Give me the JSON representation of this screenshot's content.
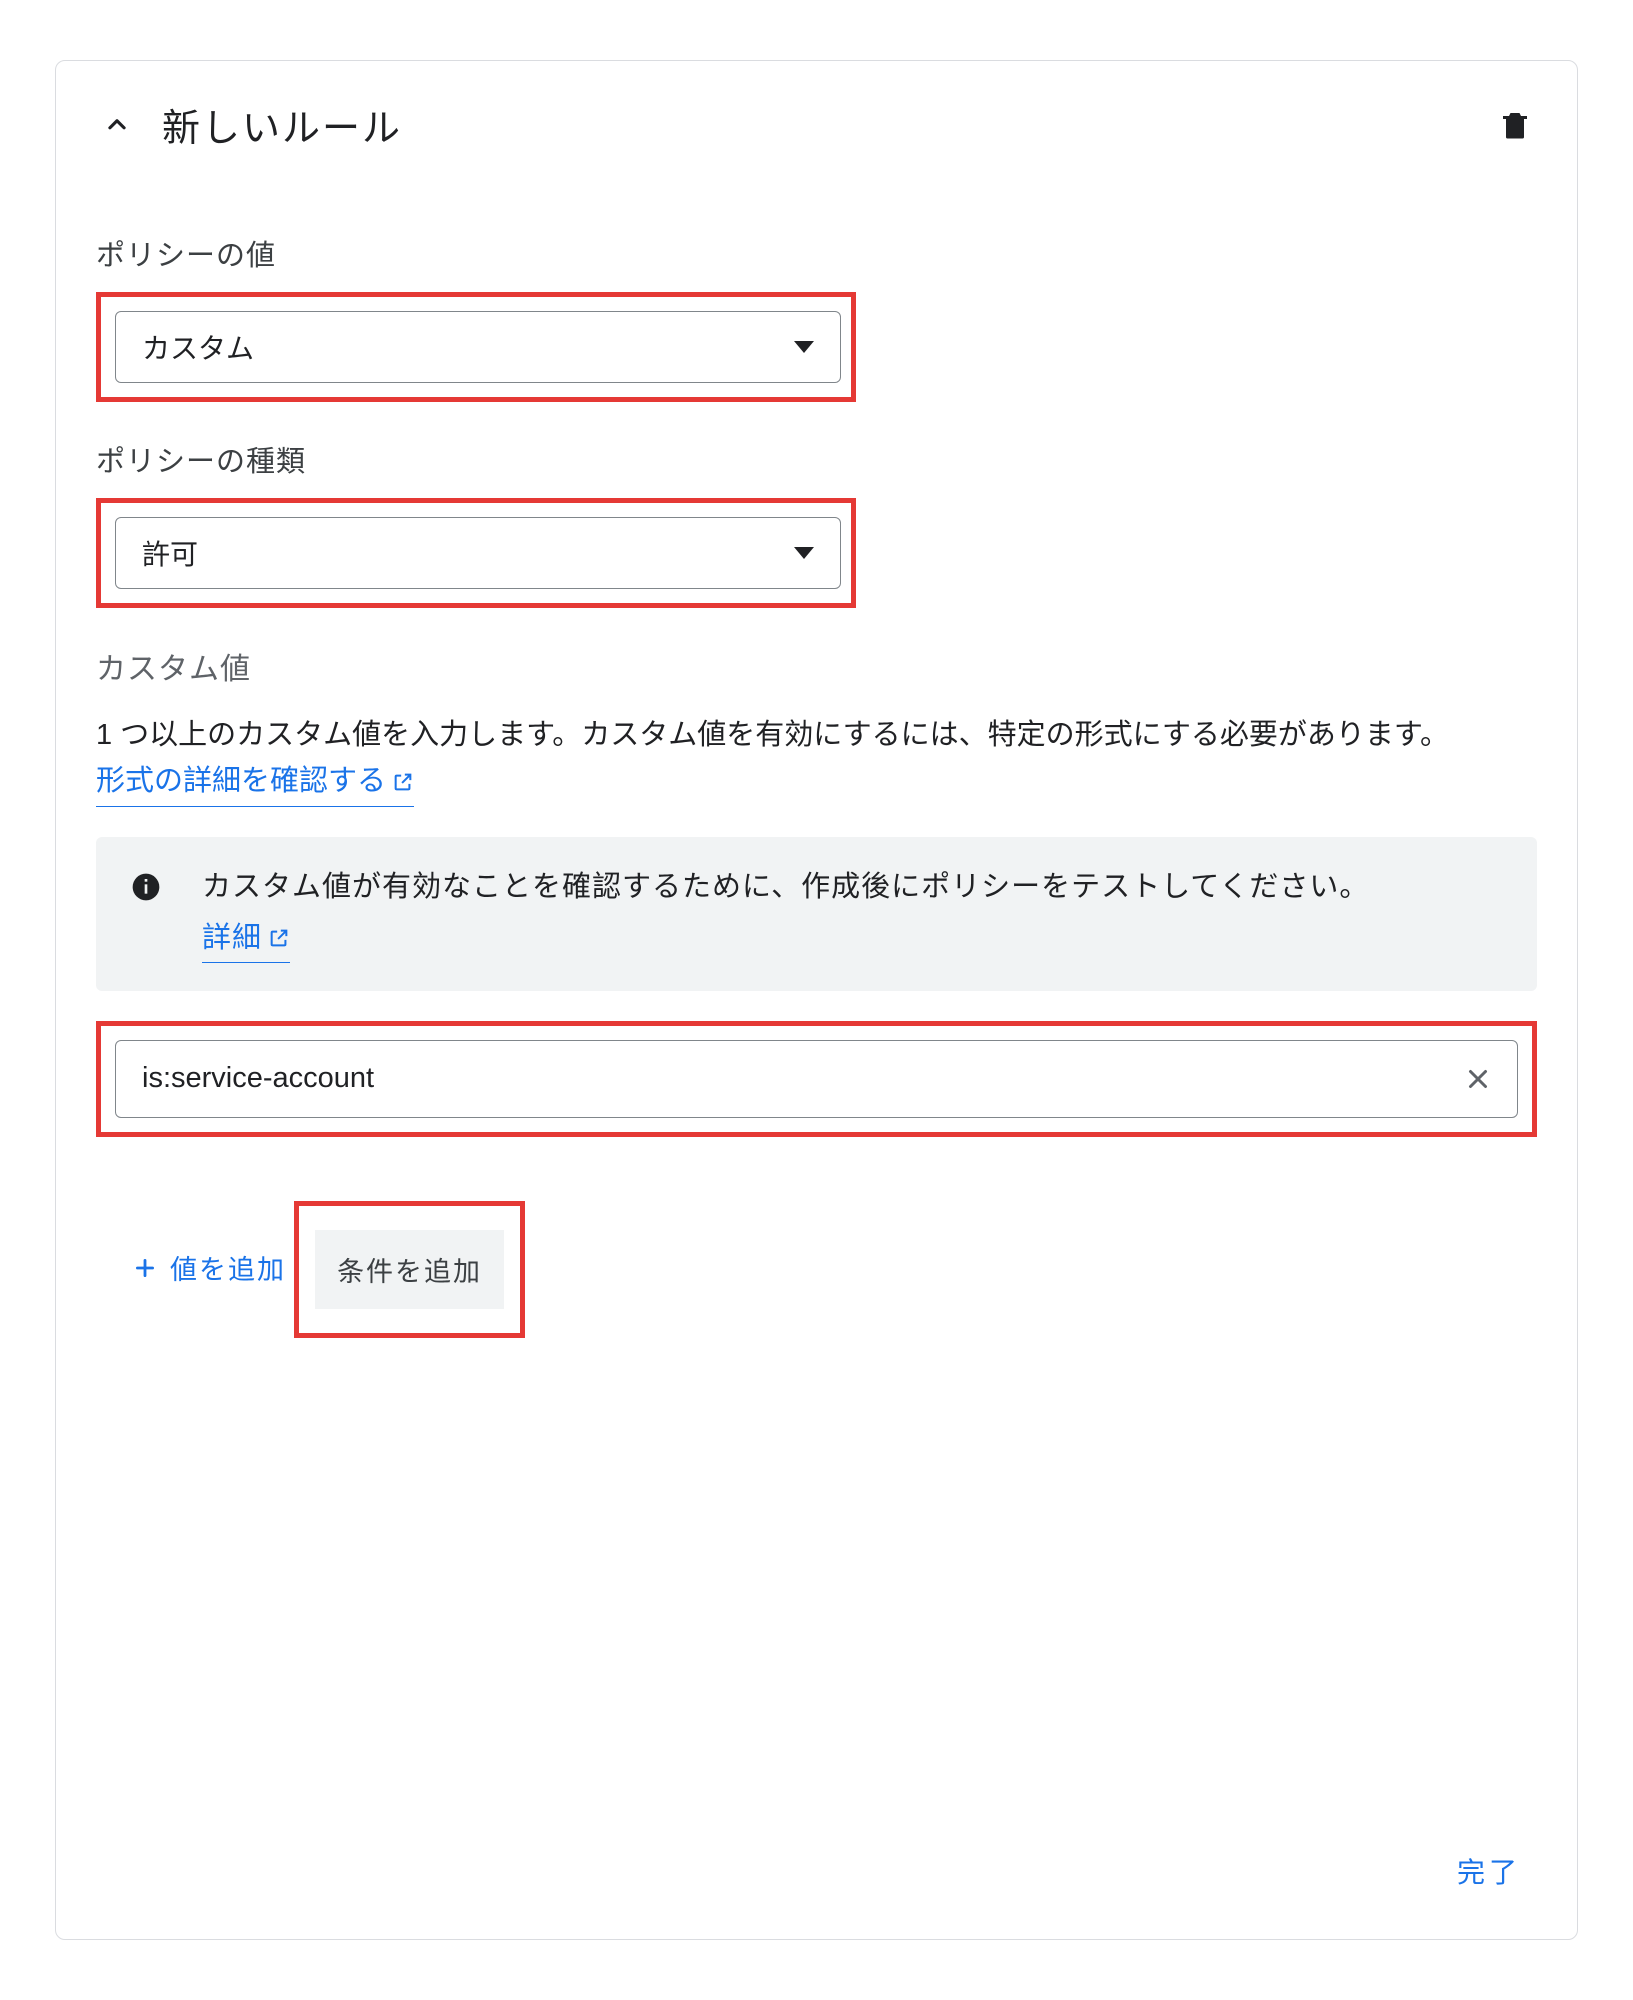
{
  "header": {
    "title": "新しいルール"
  },
  "policyValue": {
    "label": "ポリシーの値",
    "selected": "カスタム"
  },
  "policyType": {
    "label": "ポリシーの種類",
    "selected": "許可"
  },
  "customValues": {
    "title": "カスタム値",
    "description": "1 つ以上のカスタム値を入力します。カスタム値を有効にするには、特定の形式にする必要があります。",
    "formatLink": "形式の詳細を確認する",
    "infoText": "カスタム値が有効なことを確認するために、作成後にポリシーをテストしてください。",
    "infoLink": "詳細",
    "value0": "is:service-account",
    "addValueLabel": "値を追加"
  },
  "addCondition": "条件を追加",
  "done": "完了"
}
